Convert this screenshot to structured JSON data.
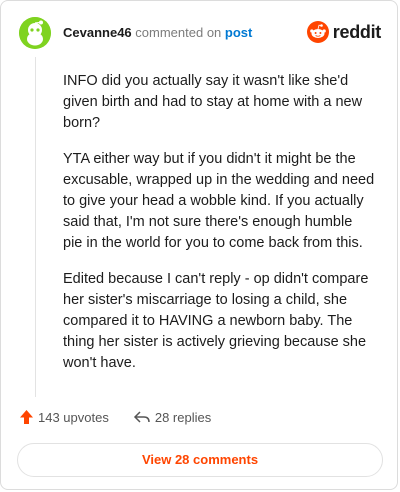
{
  "header": {
    "username": "Cevanne46",
    "action_text": "commented on",
    "post_link": "post"
  },
  "logo": {
    "wordmark": "reddit",
    "icon": "reddit-alien-icon",
    "color": "#ff4500"
  },
  "avatar": {
    "icon": "snoo-avatar-icon",
    "color": "#7fd320"
  },
  "comment": {
    "paragraphs": [
      "INFO did you actually say it wasn't like she'd given birth and had to stay at home with a new born?",
      "YTA either way but if you didn't it might be the excusable, wrapped up in the wedding and need to give your head a wobble kind. If you actually said that, I'm not sure there's enough humble pie in the world for you to come back from this.",
      "Edited because I can't reply - op didn't compare her sister's miscarriage to losing a child, she compared it to HAVING a newborn baby. The thing her sister is actively grieving because she won't have."
    ]
  },
  "actions": {
    "upvotes": "143 upvotes",
    "upvote_icon": "upvote-arrow-icon",
    "replies": "28 replies",
    "reply_icon": "reply-arrow-icon"
  },
  "view_button": {
    "label": "View 28 comments"
  }
}
